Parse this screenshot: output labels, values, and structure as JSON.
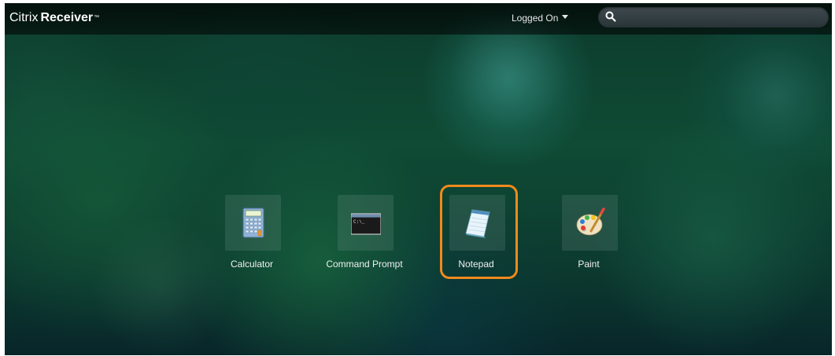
{
  "header": {
    "brand_light": "Citrix",
    "brand_bold": "Receiver",
    "trademark": "™",
    "user_menu_label": "Logged On",
    "search": {
      "value": "",
      "placeholder": ""
    }
  },
  "apps": [
    {
      "label": "Calculator",
      "icon": "calculator-icon"
    },
    {
      "label": "Command Prompt",
      "icon": "command-prompt-icon"
    },
    {
      "label": "Notepad",
      "icon": "notepad-icon",
      "highlighted": true
    },
    {
      "label": "Paint",
      "icon": "paint-palette-icon"
    }
  ],
  "colors": {
    "highlight": "#f08a1c",
    "header_bg": "#0b0b0b",
    "background": "#0f4b35"
  }
}
